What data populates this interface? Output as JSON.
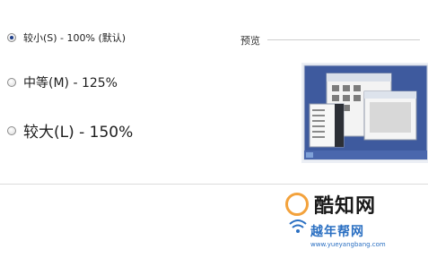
{
  "options": [
    {
      "label": "较小(S) - 100% (默认)",
      "checked": true
    },
    {
      "label": "中等(M) - 125%",
      "checked": false
    },
    {
      "label": "较大(L) - 150%",
      "checked": false
    }
  ],
  "preview": {
    "label": "预览"
  },
  "watermark": {
    "brand": "酷知网",
    "site": "越年帮网",
    "url": "www.yueyangbang.com"
  },
  "colors": {
    "desktop_blue": "#3e5a9e",
    "taskbar_blue": "#4a67ad",
    "watermark_orange": "#f3a23c",
    "watermark_blue": "#2a6fc2"
  }
}
